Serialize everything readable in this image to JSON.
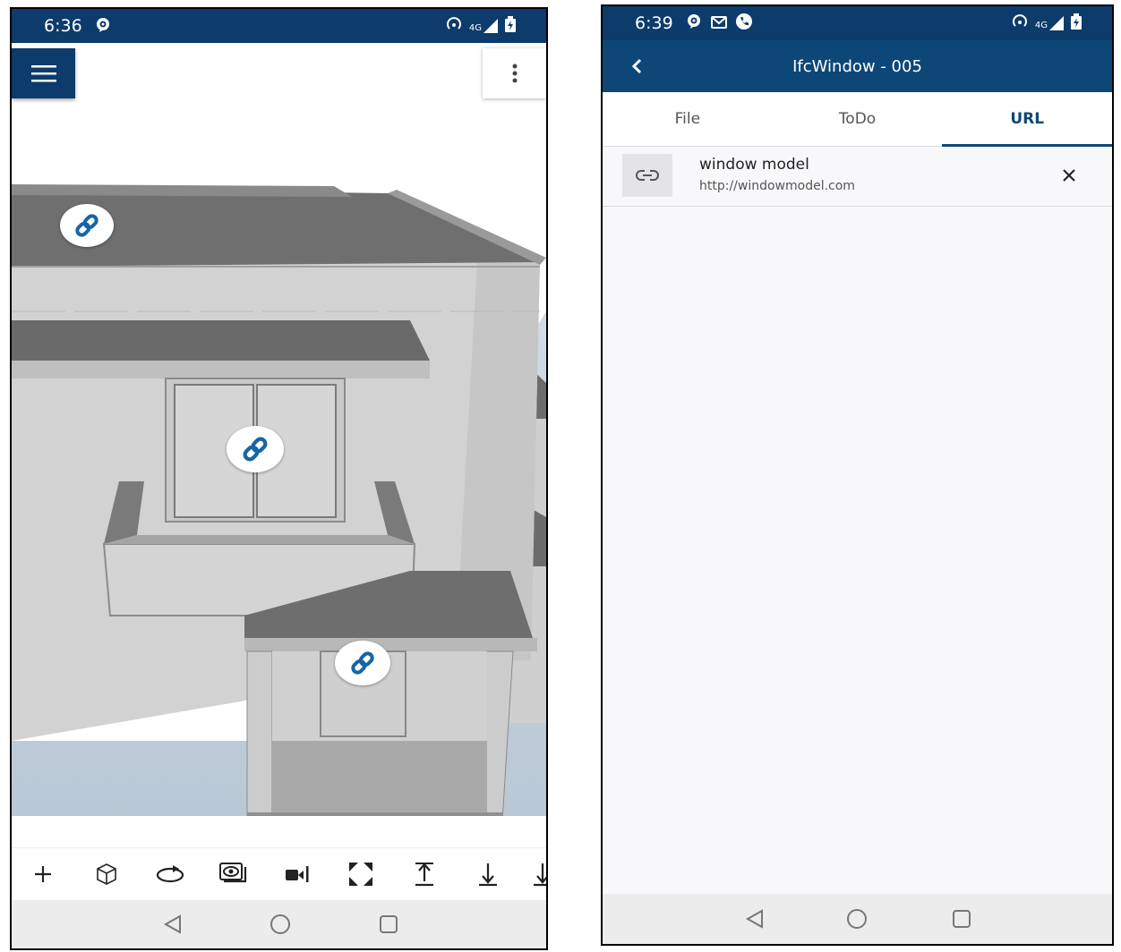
{
  "left_screen": {
    "status_bar": {
      "time": "6:36",
      "network": "4G"
    },
    "toolbar_tools": [
      {
        "name": "add",
        "icon": "plus-icon"
      },
      {
        "name": "3d-view",
        "icon": "cube-icon"
      },
      {
        "name": "rotate",
        "icon": "rotate-icon"
      },
      {
        "name": "visibility",
        "icon": "eye-layers-icon"
      },
      {
        "name": "camera",
        "icon": "video-camera-icon"
      },
      {
        "name": "fit-to-screen",
        "icon": "expand-icon"
      },
      {
        "name": "level-up",
        "icon": "arrow-up-bar-icon"
      },
      {
        "name": "level-down",
        "icon": "arrow-down-bar-icon"
      },
      {
        "name": "level-down-2",
        "icon": "arrow-down-bar-icon"
      }
    ],
    "link_markers": 3
  },
  "right_screen": {
    "status_bar": {
      "time": "6:39",
      "network": "4G"
    },
    "title": "IfcWindow - 005",
    "tabs": [
      {
        "label": "File",
        "active": false
      },
      {
        "label": "ToDo",
        "active": false
      },
      {
        "label": "URL",
        "active": true
      }
    ],
    "urls": [
      {
        "name": "window model",
        "address": "http://windowmodel.com"
      }
    ]
  },
  "colors": {
    "primary": "#0d3b6b",
    "marker_link": "#1565a6"
  }
}
